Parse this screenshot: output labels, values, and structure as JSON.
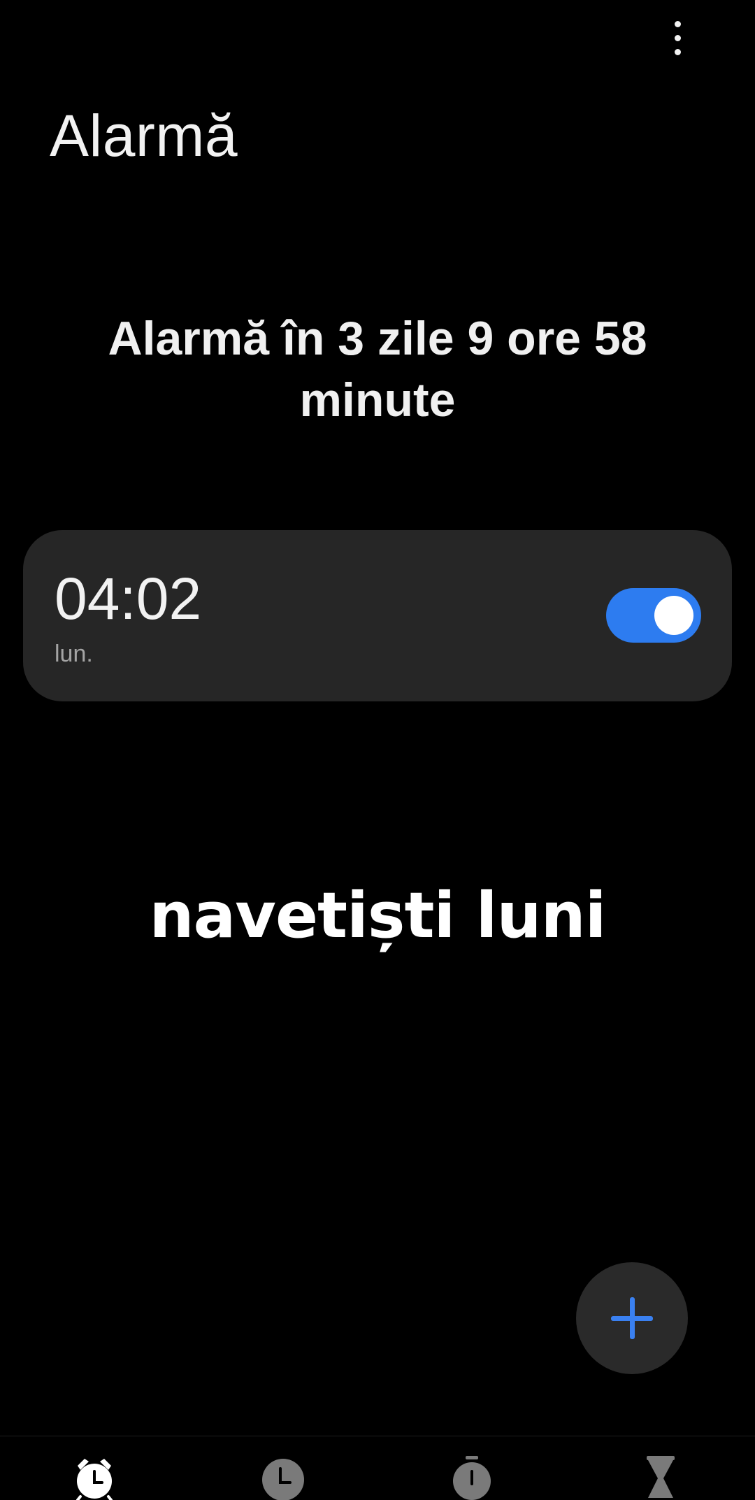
{
  "header": {
    "title": "Alarmă",
    "more_icon": "more-vertical-icon"
  },
  "summary": {
    "next_alarm_text": "Alarmă în 3 zile 9 ore 58 minute"
  },
  "alarms": [
    {
      "time": "04:02",
      "days": "lun.",
      "enabled": true
    }
  ],
  "overlay": {
    "caption": "navetiști luni"
  },
  "fab": {
    "icon": "plus-icon"
  },
  "bottom_nav": {
    "items": [
      {
        "icon": "alarm-clock-icon",
        "active": true
      },
      {
        "icon": "world-clock-icon",
        "active": false
      },
      {
        "icon": "stopwatch-icon",
        "active": false
      },
      {
        "icon": "hourglass-icon",
        "active": false
      }
    ]
  },
  "colors": {
    "background": "#000000",
    "card": "#262626",
    "accent": "#2d7cf0",
    "text_primary": "#f2f2f2",
    "text_secondary": "#a4a4a4"
  }
}
